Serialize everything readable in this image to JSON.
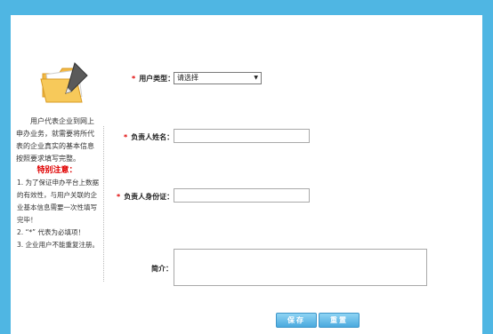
{
  "sidebar": {
    "intro": "用户代表企业到网上申办业务，就需要将所代表的企业真实的基本信息按照要求填写完整。",
    "notice_title": "特别注意：",
    "notes": [
      "1. 为了保证申办平台上数据的有效性，与用户关联的企业基本信息需要一次性填写完毕！",
      "2. “*” 代表为必填项！",
      "3. 企业用户不能重复注册。"
    ]
  },
  "form": {
    "required_mark": "*",
    "user_type_label": "用户类型：",
    "user_type_value": "请选择",
    "manager_name_label": "负责人姓名：",
    "manager_id_label": "负责人身份证：",
    "intro_label": "简介："
  },
  "buttons": {
    "save": "保存",
    "reset": "重置"
  },
  "colors": {
    "background": "#4fb6e3",
    "required": "#e00000",
    "button": "#4aa9de"
  },
  "icons": {
    "sidebar_image": "folder-with-pen-icon"
  }
}
